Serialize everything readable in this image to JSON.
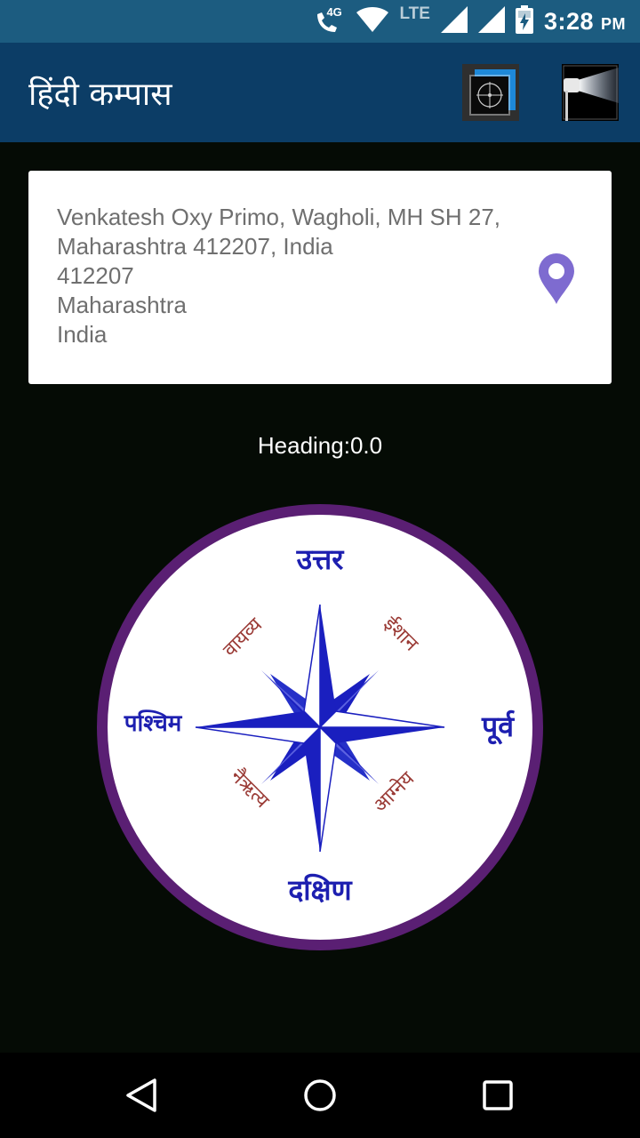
{
  "status_bar": {
    "network_label": "4G",
    "lte_label": "LTE",
    "time": "3:28",
    "ampm": "PM"
  },
  "app_bar": {
    "title": "हिंदी कम्पास"
  },
  "address": {
    "lines": [
      "Venkatesh Oxy Primo, Wagholi, MH SH 27,",
      "Maharashtra 412207, India",
      "412207",
      "Maharashtra",
      "India"
    ]
  },
  "heading": {
    "text": "Heading:0.0"
  },
  "compass": {
    "north": "उत्तर",
    "south": "दक्षिण",
    "east": "पूर्व",
    "west": "पश्चिम",
    "northeast": "ईशान",
    "northwest": "वायव्य",
    "southeast": "आग्नेय",
    "southwest": "नैऋत्य",
    "ring_color": "#5a1f73",
    "star_color": "#1a1fbf",
    "cardinal_color": "#1d1fb0",
    "intercardinal_color": "#9a3a35"
  },
  "colors": {
    "status_bar": "#1c5c80",
    "app_bar": "#0c3d66",
    "background": "#050b05",
    "pin": "#7e6bd0"
  }
}
